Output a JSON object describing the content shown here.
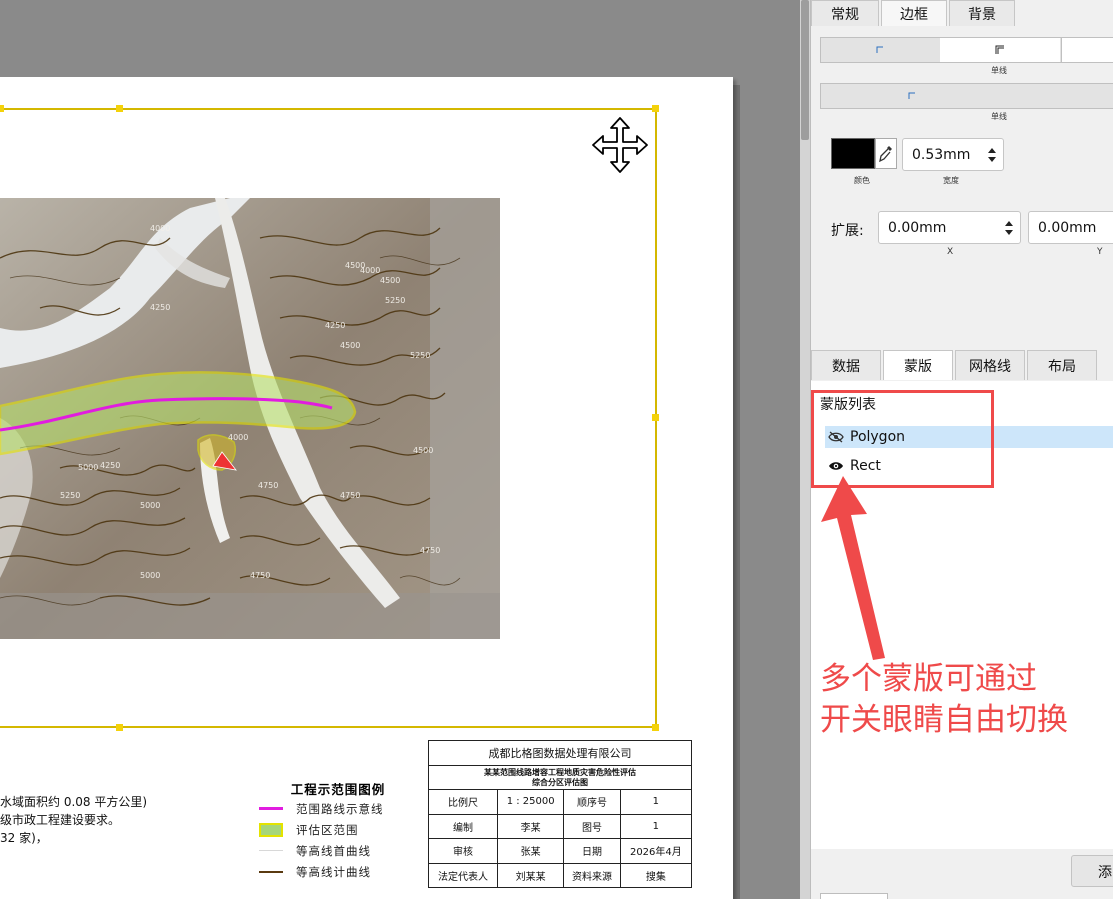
{
  "canvas": {
    "map": {
      "contour_labels": [
        "4000",
        "4250",
        "4500",
        "4750",
        "5000",
        "5250",
        "4000",
        "4250",
        "4500",
        "4750",
        "5000",
        "5250",
        "4250",
        "4500",
        "4750",
        "5000",
        "5250",
        "4000",
        "4500",
        "4750"
      ]
    },
    "notes": {
      "lines": [
        "水域面积约 0.08 平方公里)",
        "级市政工程建设要求。",
        " 32 家)，"
      ]
    },
    "legend": {
      "title": "工程示范围图例",
      "items": [
        {
          "label": "范围路线示意线",
          "color": "#e11ce0",
          "kind": "line"
        },
        {
          "label": "评估区范围",
          "color": "#a6d67a",
          "border": "#e3e300",
          "kind": "box"
        },
        {
          "label": "等高线首曲线",
          "color": "#e0e0e0",
          "kind": "thin"
        },
        {
          "label": "等高线计曲线",
          "color": "#5a3a10",
          "kind": "line"
        }
      ]
    },
    "title_block": {
      "company": "成都比格图数据处理有限公司",
      "project_line1": "某某范围线路增容工程地质灾害危险性评估",
      "project_line2": "综合分区评估图",
      "rows": [
        [
          "比例尺",
          "1 : 25000",
          "顺序号",
          "1"
        ],
        [
          "编制",
          "李某",
          "图号",
          "1"
        ],
        [
          "审核",
          "张某",
          "日期",
          "2026年4月"
        ],
        [
          "法定代表人",
          "刘某某",
          "资料来源",
          "搜集"
        ]
      ]
    }
  },
  "panel": {
    "top_tabs": [
      "常规",
      "边框",
      "背景"
    ],
    "top_tabs_active": 1,
    "border": {
      "line_style_label_1": "单线",
      "line_style_label_2": "单线",
      "color_hex": "#000000",
      "color_label": "颜色",
      "width_value": "0.53mm",
      "width_label": "宽度",
      "expand_label": "扩展:",
      "expand_x": "0.00mm",
      "expand_y": "0.00mm",
      "x_label": "X",
      "y_label": "Y"
    },
    "bottom_tabs": [
      "数据",
      "蒙版",
      "网格线",
      "布局"
    ],
    "bottom_tabs_active": 1,
    "mask_list": {
      "title": "蒙版列表",
      "items": [
        {
          "name": "Polygon",
          "icon": "eye-hidden-icon",
          "selected": true
        },
        {
          "name": "Rect",
          "icon": "eye-icon",
          "selected": false
        }
      ]
    },
    "add_button": "添"
  },
  "annotation": {
    "line1": "多个蒙版可通过",
    "line2": "开关眼睛自由切换",
    "color": "#ef4a4a"
  }
}
